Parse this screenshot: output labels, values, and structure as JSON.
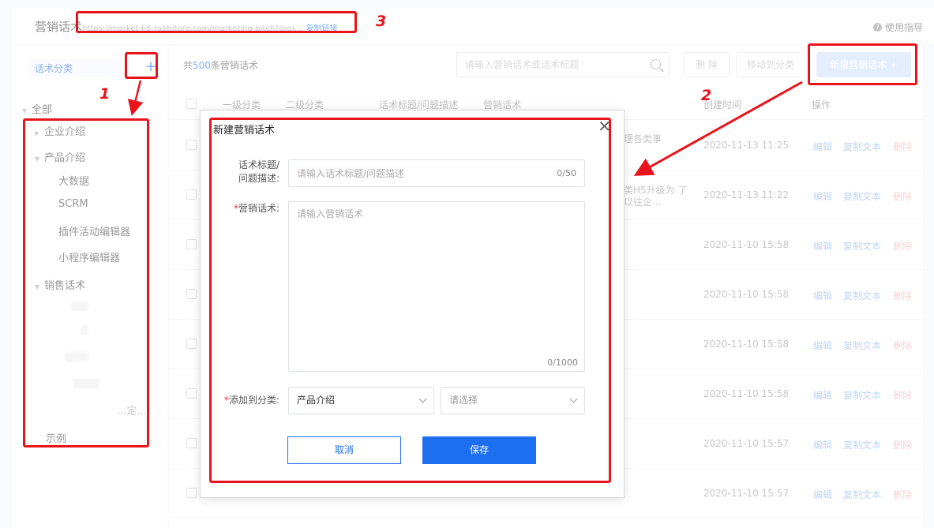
{
  "header": {
    "title": "营销话术",
    "url": "https://market-h5.rabbitpre.com/marketing-pitch?orgI...",
    "copy_link": "复制链接",
    "guide": "使用指导",
    "guide_icon": "question-circle-icon"
  },
  "sidebar": {
    "category_label": "话术分类",
    "add_icon": "plus-icon",
    "root": "全部",
    "items": [
      {
        "label": "企业介绍"
      },
      {
        "label": "产品介绍",
        "children": [
          "大数据",
          "SCRM",
          "插件活动编辑器",
          "小程序编辑器"
        ]
      },
      {
        "label": "销售话术",
        "partial": [
          "...定..."
        ]
      },
      {
        "label": "示例"
      }
    ],
    "partial_visible": [
      "...."
    ]
  },
  "toolbar": {
    "count_prefix": "共",
    "count": "500",
    "count_suffix": "条营销话术",
    "search_placeholder": "请输入营销话术或话术标题",
    "delete_label": "删 除",
    "move_label": "移动到分类",
    "add_label": "新增营销话术 +"
  },
  "table": {
    "headers": [
      "一级分类",
      "二级分类",
      "话术标题/问题描述",
      "营销话术",
      "创建时间",
      "操作"
    ],
    "rows": [
      {
        "snippet": "理各类事",
        "time": "2020-11-13 11:25"
      },
      {
        "snippet": "类H5升级为 了以往企...",
        "time": "2020-11-13 11:22"
      },
      {
        "snippet": "",
        "time": "2020-11-10 15:58"
      },
      {
        "snippet": "",
        "time": "2020-11-10 15:58"
      },
      {
        "snippet": "",
        "time": "2020-11-10 15:58"
      },
      {
        "snippet": "",
        "time": "2020-11-10 15:58"
      },
      {
        "snippet": "",
        "time": "2020-11-10 15:57"
      },
      {
        "snippet": "",
        "time": "2020-11-10 15:57"
      }
    ],
    "op_edit": "编辑",
    "op_copy": "复制文本",
    "op_delete": "删除"
  },
  "modal": {
    "title": "新建营销话术",
    "close_icon": "close-icon",
    "title_label_line1": "话术标题/",
    "title_label_line2": "问题描述:",
    "title_placeholder": "请输入话术标题/问题描述",
    "title_counter": "0/50",
    "content_label": "营销话术:",
    "content_placeholder": "请输入营销话术",
    "content_counter": "0/1000",
    "category_label": "添加到分类:",
    "category_value": "产品介绍",
    "subcategory_placeholder": "请选择",
    "cancel": "取消",
    "save": "保存"
  },
  "annotations": [
    "1",
    "2",
    "3"
  ],
  "colors": {
    "primary": "#1d6ff2",
    "annotation": "#e8131b",
    "danger": "#f3b0b0"
  }
}
